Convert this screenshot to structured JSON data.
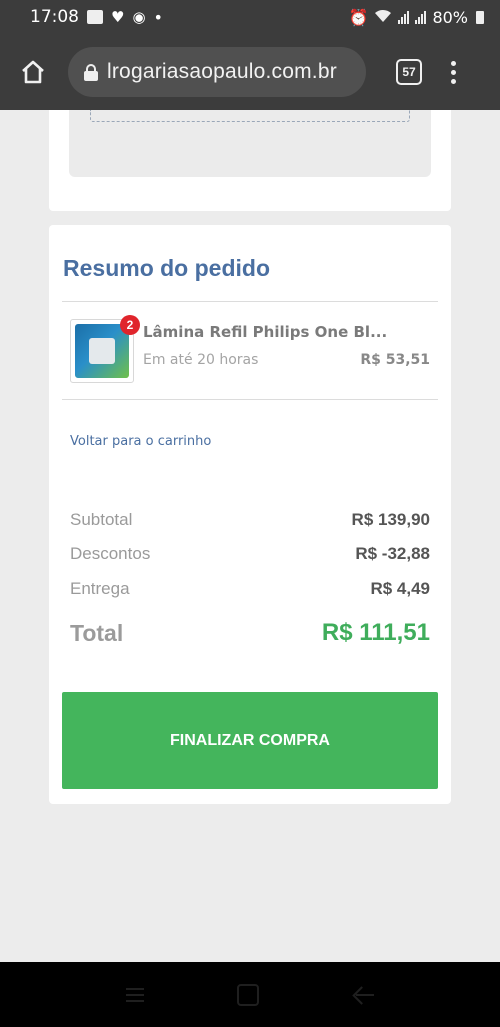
{
  "status_bar": {
    "time": "17:08",
    "battery": "80%",
    "dot": "•"
  },
  "browser": {
    "url": "lrogariasaopaulo.com.br",
    "tab_count": "57"
  },
  "order_summary": {
    "title": "Resumo do pedido",
    "product": {
      "name": "Lâmina Refil Philips One Bl...",
      "quantity_badge": "2",
      "delivery": "Em até 20 horas",
      "price": "R$ 53,51"
    },
    "back_link": "Voltar para o carrinho",
    "totals": {
      "subtotal_label": "Subtotal",
      "subtotal_value": "R$ 139,90",
      "discounts_label": "Descontos",
      "discounts_value": "R$ -32,88",
      "delivery_label": "Entrega",
      "delivery_value": "R$ 4,49",
      "total_label": "Total",
      "total_value": "R$ 111,51"
    },
    "checkout_button": "FINALIZAR COMPRA"
  },
  "colors": {
    "accent_green": "#44b55c",
    "title_blue": "#4a6fa1",
    "badge_red": "#e0252c"
  }
}
